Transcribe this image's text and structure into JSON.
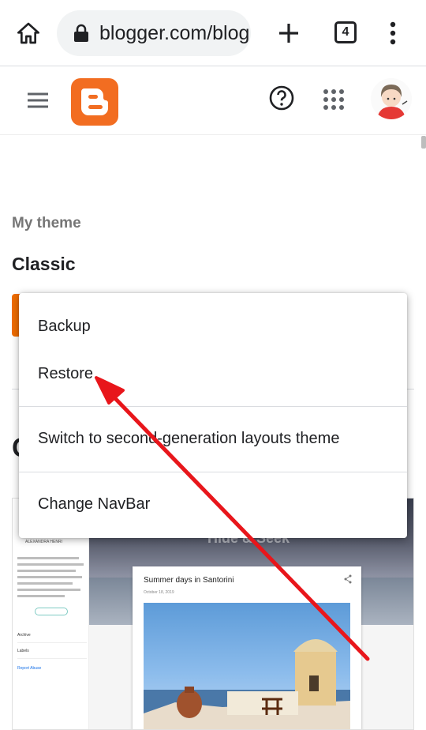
{
  "browser": {
    "url": "blogger.com/blog",
    "tab_count": "4",
    "icons": {
      "home": "home-icon",
      "lock": "lock-icon",
      "new_tab": "plus-icon",
      "tabs": "tab-switcher-icon",
      "more": "more-vert-icon"
    }
  },
  "header": {
    "icons": {
      "menu": "hamburger-menu-icon",
      "logo": "blogger-logo-icon",
      "help": "help-circle-icon",
      "apps": "apps-grid-icon",
      "avatar": "user-avatar"
    },
    "logo_color": "#f26d21"
  },
  "content": {
    "my_theme_label": "My theme",
    "theme_name": "Classic",
    "section_heading": "C"
  },
  "preview": {
    "blog_title": "Hide & Seek",
    "author_name": "ALEXANDRA HENRI",
    "sidebar_rows": [
      "Archive",
      "Labels"
    ],
    "report_link": "Report Abuse",
    "post_title": "Summer days in Santorini",
    "post_date": "October 18, 2019"
  },
  "menu": {
    "items": [
      {
        "label": "Backup"
      },
      {
        "label": "Restore"
      },
      {
        "label": "Switch to second-generation layouts theme"
      },
      {
        "label": "Change NavBar"
      }
    ]
  },
  "colors": {
    "accent_orange": "#ef6c00",
    "annotation_arrow": "#e8161b"
  }
}
